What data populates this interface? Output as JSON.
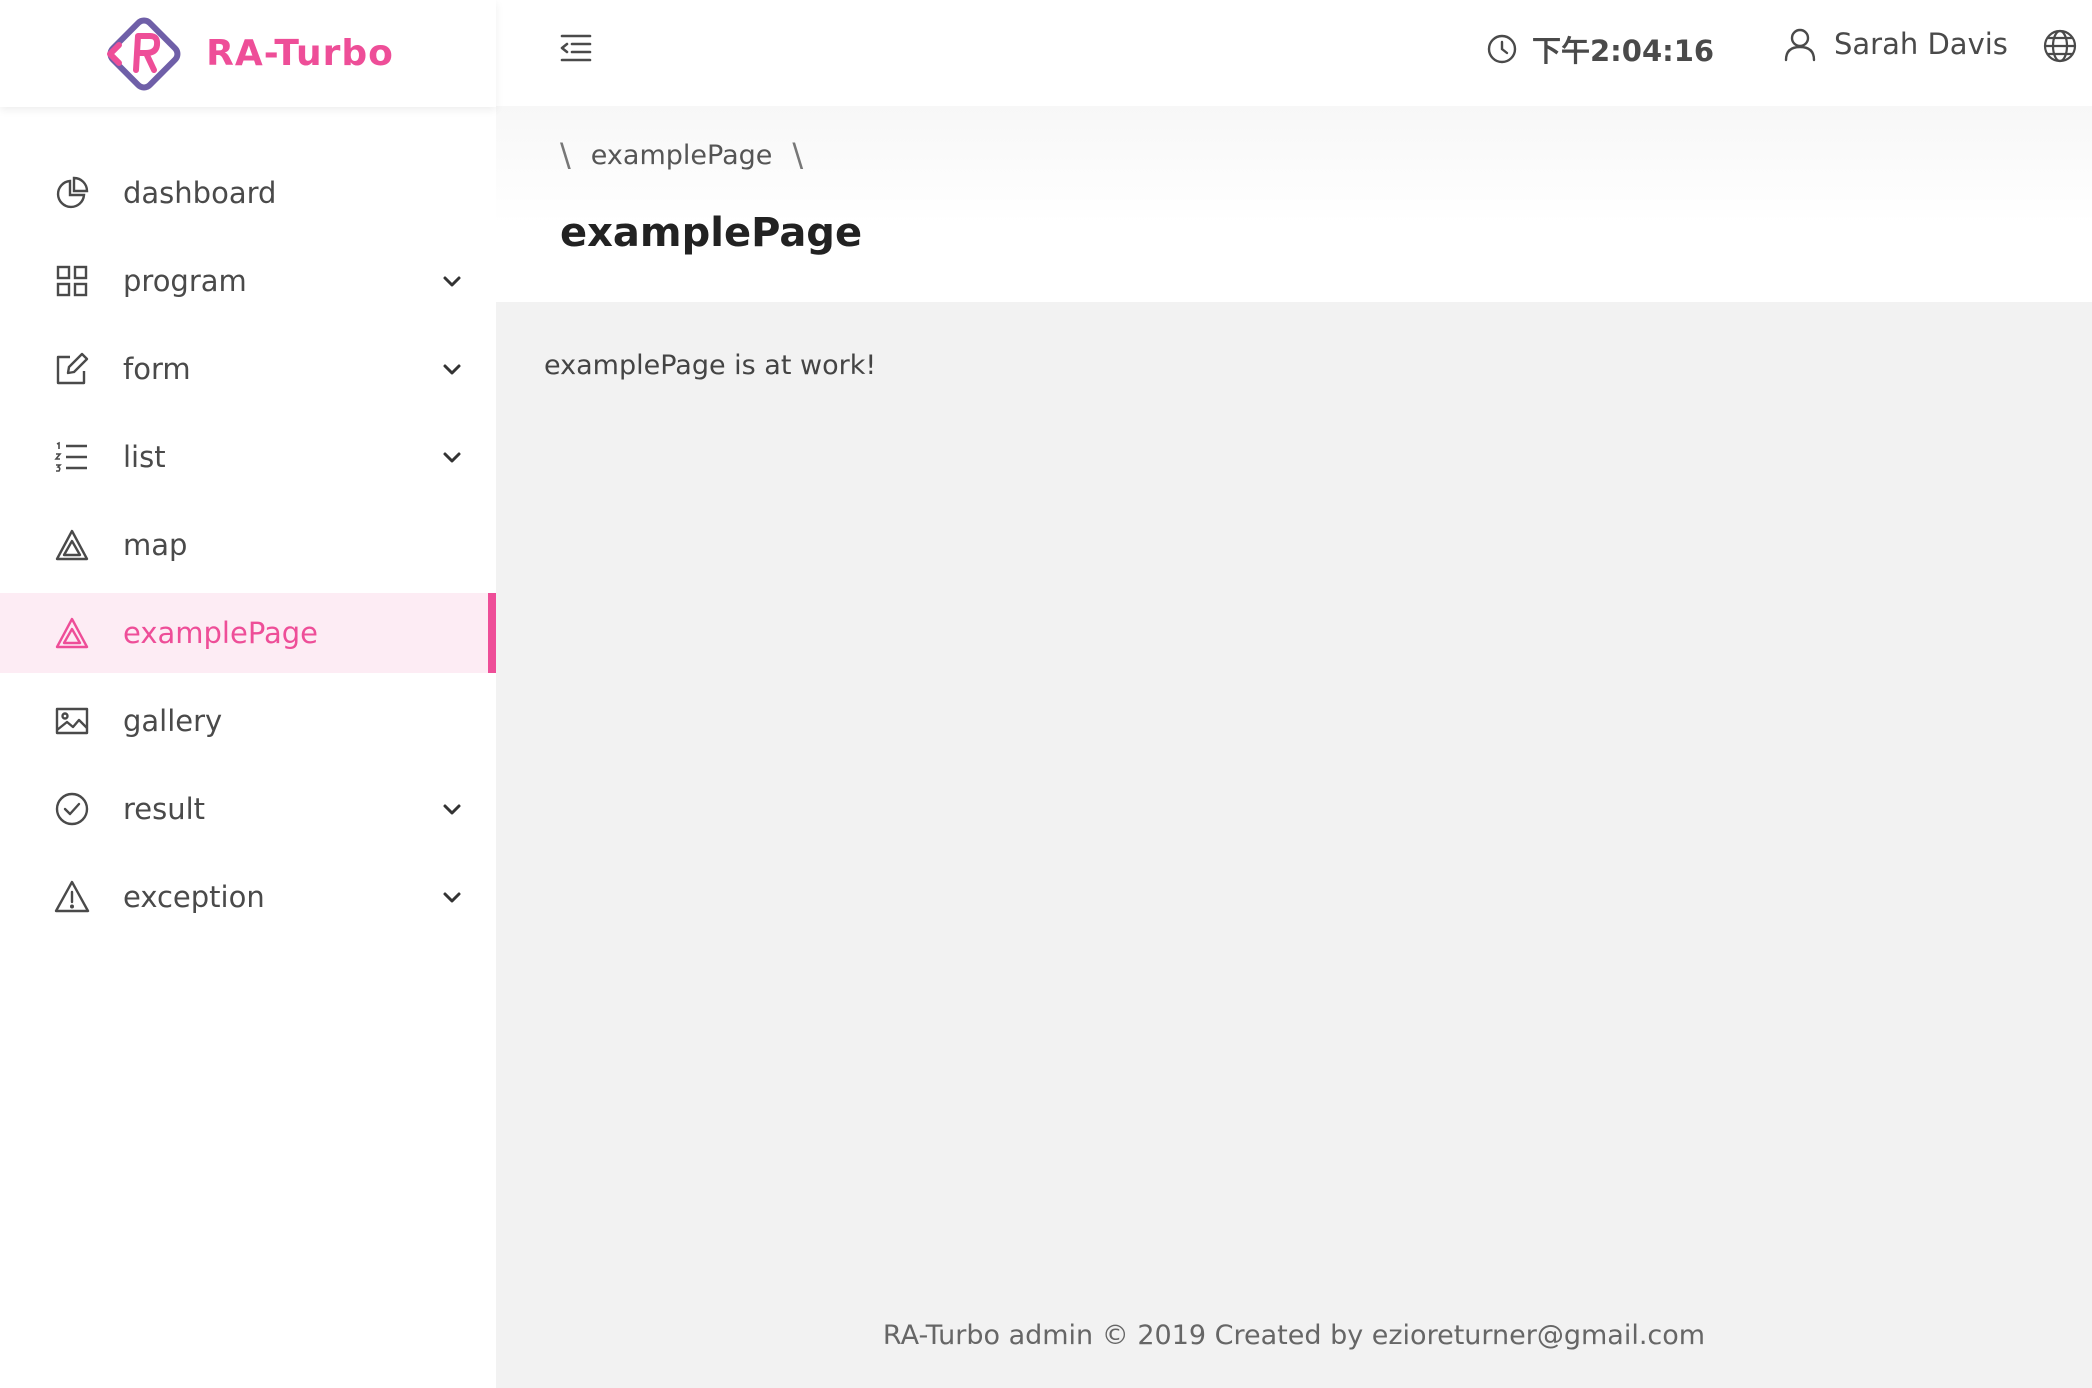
{
  "brand": {
    "name": "RA-Turbo",
    "color": "#ee4e98",
    "logo_icon": "ra-turbo-logo-icon"
  },
  "sidebar": {
    "items": [
      {
        "label": "dashboard",
        "icon": "pie-chart-icon",
        "has_submenu": false
      },
      {
        "label": "program",
        "icon": "grid-icon",
        "has_submenu": true
      },
      {
        "label": "form",
        "icon": "edit-icon",
        "has_submenu": true
      },
      {
        "label": "list",
        "icon": "ordered-list-icon",
        "has_submenu": true
      },
      {
        "label": "map",
        "icon": "triangle-icon",
        "has_submenu": false
      },
      {
        "label": "examplePage",
        "icon": "triangle-icon",
        "has_submenu": false,
        "active": true
      },
      {
        "label": "gallery",
        "icon": "picture-icon",
        "has_submenu": false
      },
      {
        "label": "result",
        "icon": "check-circle-icon",
        "has_submenu": true
      },
      {
        "label": "exception",
        "icon": "warning-icon",
        "has_submenu": true
      }
    ]
  },
  "header": {
    "menu_fold_icon": "menu-fold-icon",
    "clock_icon": "clock-icon",
    "time": "下午2:04:16",
    "user_icon": "user-icon",
    "user_name": "Sarah Davis",
    "language_icon": "globe-icon"
  },
  "page": {
    "breadcrumb": [
      "examplePage"
    ],
    "breadcrumb_separator": "\\",
    "title": "examplePage",
    "body_text": "examplePage is at work!"
  },
  "footer": {
    "text": "RA-Turbo admin © 2019 Created by ezioreturner@gmail.com"
  }
}
